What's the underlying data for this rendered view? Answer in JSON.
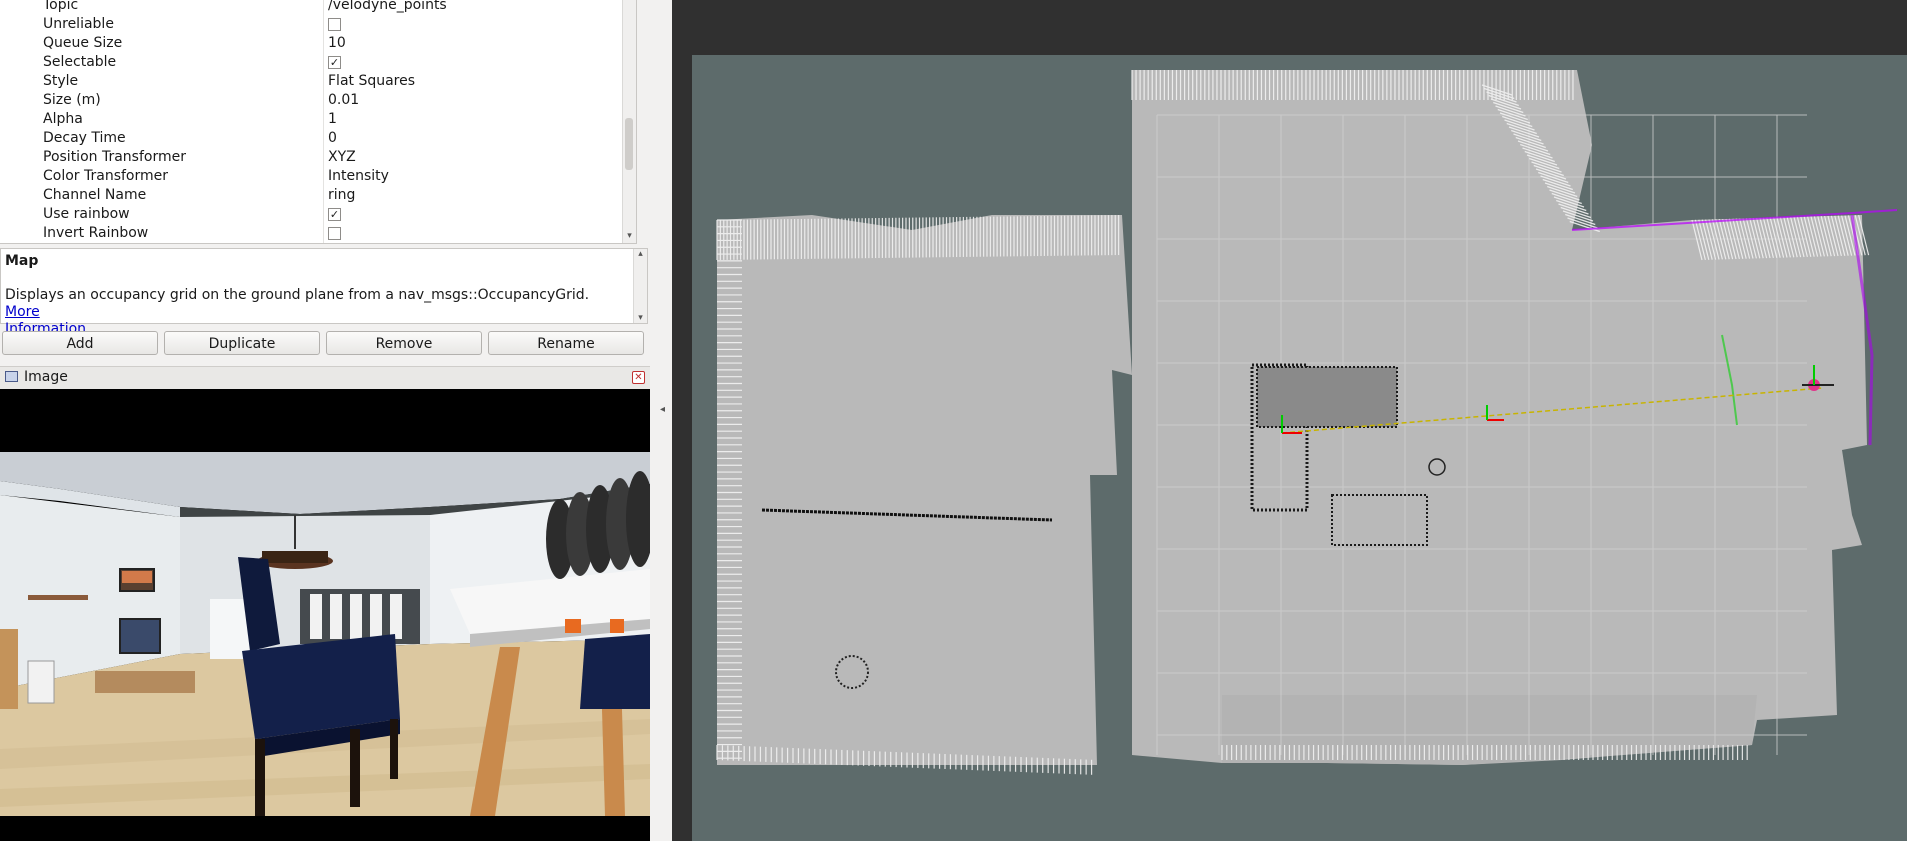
{
  "properties": [
    {
      "name": "Topic",
      "value": "/velodyne_points",
      "type": "text"
    },
    {
      "name": "Unreliable",
      "value": false,
      "type": "checkbox"
    },
    {
      "name": "Queue Size",
      "value": "10",
      "type": "text"
    },
    {
      "name": "Selectable",
      "value": true,
      "type": "checkbox"
    },
    {
      "name": "Style",
      "value": "Flat Squares",
      "type": "text"
    },
    {
      "name": "Size (m)",
      "value": "0.01",
      "type": "text"
    },
    {
      "name": "Alpha",
      "value": "1",
      "type": "text"
    },
    {
      "name": "Decay Time",
      "value": "0",
      "type": "text"
    },
    {
      "name": "Position Transformer",
      "value": "XYZ",
      "type": "text"
    },
    {
      "name": "Color Transformer",
      "value": "Intensity",
      "type": "text"
    },
    {
      "name": "Channel Name",
      "value": "ring",
      "type": "text"
    },
    {
      "name": "Use rainbow",
      "value": true,
      "type": "checkbox"
    },
    {
      "name": "Invert Rainbow",
      "value": false,
      "type": "checkbox"
    }
  ],
  "description": {
    "title": "Map",
    "text": "Displays an occupancy grid on the ground plane from a nav_msgs::OccupancyGrid.",
    "link_text_1": "More",
    "link_text_2": "Information",
    "trailing": "."
  },
  "buttons": {
    "add": "Add",
    "duplicate": "Duplicate",
    "remove": "Remove",
    "rename": "Rename"
  },
  "image_panel": {
    "title": "Image"
  },
  "icons": {
    "checkmark": "✓",
    "close": "✕",
    "collapse": "◂",
    "scroll_down": "▾",
    "scroll_up": "▴"
  },
  "colors": {
    "map_background": "#5d6b6b",
    "map_free": "#b9b9b9",
    "grid_line": "#d8d8d8",
    "path": "#c8b400"
  }
}
